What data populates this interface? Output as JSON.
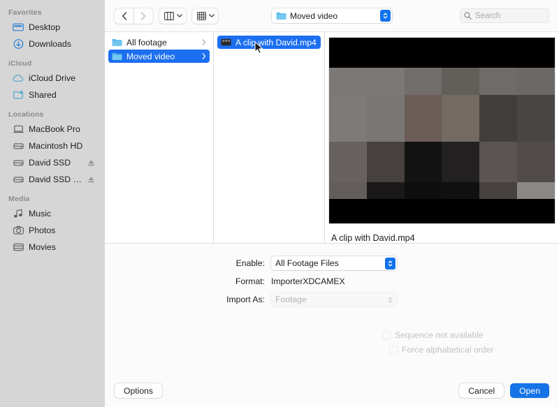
{
  "sidebar": {
    "groups": [
      {
        "title": "Favorites",
        "items": [
          {
            "label": "Desktop",
            "icon": "desktop-icon",
            "eject": false
          },
          {
            "label": "Downloads",
            "icon": "downloads-icon",
            "eject": false
          }
        ]
      },
      {
        "title": "iCloud",
        "items": [
          {
            "label": "iCloud Drive",
            "icon": "icloud-drive-icon",
            "eject": false
          },
          {
            "label": "Shared",
            "icon": "shared-folder-icon",
            "eject": false
          }
        ]
      },
      {
        "title": "Locations",
        "items": [
          {
            "label": "MacBook Pro",
            "icon": "laptop-icon",
            "eject": false
          },
          {
            "label": "Macintosh HD",
            "icon": "hard-drive-icon",
            "eject": false
          },
          {
            "label": "David SSD",
            "icon": "hard-drive-icon",
            "eject": true
          },
          {
            "label": "David SSD Backup",
            "icon": "hard-drive-icon",
            "eject": true
          }
        ]
      },
      {
        "title": "Media",
        "items": [
          {
            "label": "Music",
            "icon": "music-note-icon",
            "eject": false
          },
          {
            "label": "Photos",
            "icon": "camera-icon",
            "eject": false
          },
          {
            "label": "Movies",
            "icon": "film-icon",
            "eject": false
          }
        ]
      }
    ]
  },
  "toolbar": {
    "back_label": "Back",
    "forward_label": "Forward",
    "view_column_label": "Column View",
    "view_gallery_label": "Gallery View",
    "path_popup": {
      "label": "Moved video",
      "icon": "folder-icon"
    },
    "search": {
      "placeholder": "Search",
      "value": ""
    }
  },
  "browser": {
    "column1": [
      {
        "label": "All footage",
        "icon": "folder-icon",
        "selected": false,
        "has_chevron": true
      },
      {
        "label": "Moved video",
        "icon": "folder-icon",
        "selected": true,
        "has_chevron": true
      }
    ],
    "column2": [
      {
        "label": "A clip with David.mp4",
        "icon": "movie-file-icon",
        "selected": true,
        "has_chevron": false
      }
    ]
  },
  "preview": {
    "caption": "A clip with David.mp4",
    "thumbnail": {
      "description": "pixelated-video-frame",
      "letterbox_color": "#000000",
      "rows": 6,
      "cols": 6,
      "pixels": [
        [
          "#000000",
          "#000000",
          "#000000",
          "#000000",
          "#000000",
          "#000000"
        ],
        [
          "#7b7876",
          "#7b7876",
          "#716d6a",
          "#625e5a",
          "#6f6b68",
          "#6c6865"
        ],
        [
          "#7e7a77",
          "#7a7673",
          "#6b5c57",
          "#736a63",
          "#413e3b",
          "#4a4643"
        ],
        [
          "#67625f",
          "#46413e",
          "#121212",
          "#222020",
          "#5a5552",
          "#514c49"
        ],
        [
          "#635e5b",
          "#1a1818",
          "#0e0e0e",
          "#111010",
          "#474240",
          "#8b8784"
        ],
        [
          "#000000",
          "#000000",
          "#000000",
          "#000000",
          "#000000",
          "#000000"
        ]
      ]
    }
  },
  "options": {
    "enable": {
      "label": "Enable:",
      "value": "All Footage Files"
    },
    "format": {
      "label": "Format:",
      "value": "ImporterXDCAMEX"
    },
    "import_as": {
      "label": "Import As:",
      "value": "Footage",
      "disabled": true
    },
    "checkboxes": [
      {
        "label": "Sequence not available",
        "checked": false,
        "disabled": true
      },
      {
        "label": "Force alphabetical order",
        "checked": false,
        "disabled": true
      }
    ]
  },
  "footer": {
    "options_label": "Options",
    "cancel_label": "Cancel",
    "open_label": "Open"
  },
  "colors": {
    "accent": "#1c6ff0",
    "default_button": "#1473e6",
    "sidebar_bg": "#d6d6d6",
    "folder_blue": "#54b9ec"
  }
}
